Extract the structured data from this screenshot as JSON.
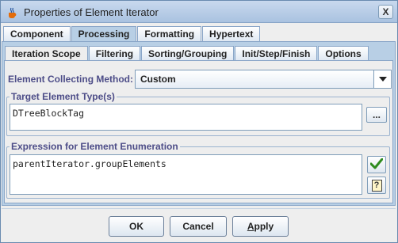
{
  "window": {
    "title": "Properties of Element Iterator",
    "close_symbol": "X"
  },
  "outer_tabs": [
    {
      "label": "Component",
      "selected": false
    },
    {
      "label": "Processing",
      "selected": true
    },
    {
      "label": "Formatting",
      "selected": false
    },
    {
      "label": "Hypertext",
      "selected": false
    }
  ],
  "inner_tabs": [
    {
      "label": "Iteration Scope",
      "selected": true
    },
    {
      "label": "Filtering",
      "selected": false
    },
    {
      "label": "Sorting/Grouping",
      "selected": false
    },
    {
      "label": "Init/Step/Finish",
      "selected": false
    },
    {
      "label": "Options",
      "selected": false
    }
  ],
  "collecting_method": {
    "label": "Element Collecting Method:",
    "value": "Custom"
  },
  "target_type": {
    "title": "Target Element Type(s)",
    "value": "DTreeBlockTag",
    "browse_label": "..."
  },
  "expression": {
    "title": "Expression for Element Enumeration",
    "value": "parentIterator.groupElements",
    "check_icon": "checkmark-icon",
    "help_label": "?"
  },
  "buttons": {
    "ok": "OK",
    "cancel": "Cancel",
    "apply": "Apply"
  },
  "colors": {
    "accent_label": "#4d4d88",
    "selected_tab": "#b8cfe5",
    "check_green": "#2e8b1e"
  }
}
